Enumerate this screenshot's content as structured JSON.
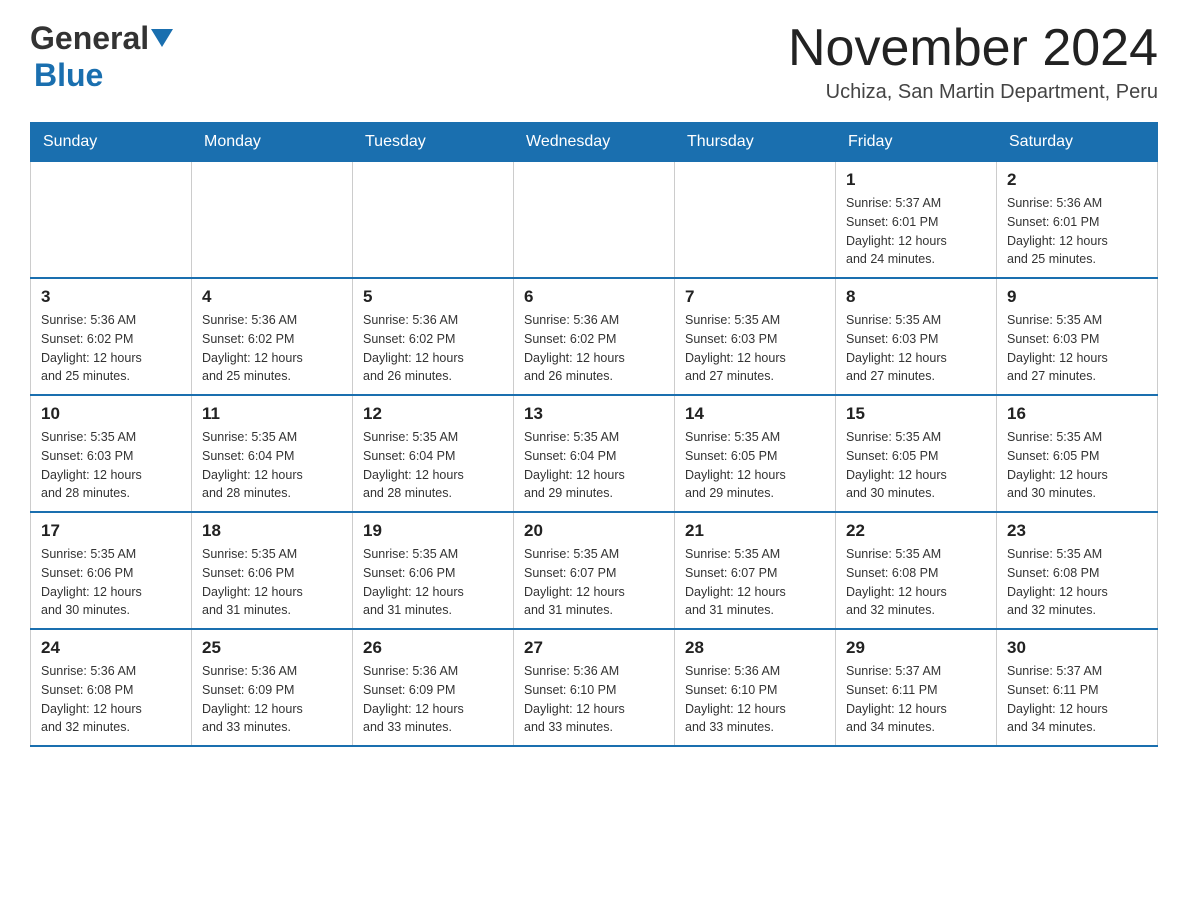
{
  "header": {
    "logo_general": "General",
    "logo_blue": "Blue",
    "main_title": "November 2024",
    "subtitle": "Uchiza, San Martin Department, Peru"
  },
  "calendar": {
    "days_of_week": [
      "Sunday",
      "Monday",
      "Tuesday",
      "Wednesday",
      "Thursday",
      "Friday",
      "Saturday"
    ],
    "weeks": [
      [
        {
          "day": "",
          "info": ""
        },
        {
          "day": "",
          "info": ""
        },
        {
          "day": "",
          "info": ""
        },
        {
          "day": "",
          "info": ""
        },
        {
          "day": "",
          "info": ""
        },
        {
          "day": "1",
          "info": "Sunrise: 5:37 AM\nSunset: 6:01 PM\nDaylight: 12 hours\nand 24 minutes."
        },
        {
          "day": "2",
          "info": "Sunrise: 5:36 AM\nSunset: 6:01 PM\nDaylight: 12 hours\nand 25 minutes."
        }
      ],
      [
        {
          "day": "3",
          "info": "Sunrise: 5:36 AM\nSunset: 6:02 PM\nDaylight: 12 hours\nand 25 minutes."
        },
        {
          "day": "4",
          "info": "Sunrise: 5:36 AM\nSunset: 6:02 PM\nDaylight: 12 hours\nand 25 minutes."
        },
        {
          "day": "5",
          "info": "Sunrise: 5:36 AM\nSunset: 6:02 PM\nDaylight: 12 hours\nand 26 minutes."
        },
        {
          "day": "6",
          "info": "Sunrise: 5:36 AM\nSunset: 6:02 PM\nDaylight: 12 hours\nand 26 minutes."
        },
        {
          "day": "7",
          "info": "Sunrise: 5:35 AM\nSunset: 6:03 PM\nDaylight: 12 hours\nand 27 minutes."
        },
        {
          "day": "8",
          "info": "Sunrise: 5:35 AM\nSunset: 6:03 PM\nDaylight: 12 hours\nand 27 minutes."
        },
        {
          "day": "9",
          "info": "Sunrise: 5:35 AM\nSunset: 6:03 PM\nDaylight: 12 hours\nand 27 minutes."
        }
      ],
      [
        {
          "day": "10",
          "info": "Sunrise: 5:35 AM\nSunset: 6:03 PM\nDaylight: 12 hours\nand 28 minutes."
        },
        {
          "day": "11",
          "info": "Sunrise: 5:35 AM\nSunset: 6:04 PM\nDaylight: 12 hours\nand 28 minutes."
        },
        {
          "day": "12",
          "info": "Sunrise: 5:35 AM\nSunset: 6:04 PM\nDaylight: 12 hours\nand 28 minutes."
        },
        {
          "day": "13",
          "info": "Sunrise: 5:35 AM\nSunset: 6:04 PM\nDaylight: 12 hours\nand 29 minutes."
        },
        {
          "day": "14",
          "info": "Sunrise: 5:35 AM\nSunset: 6:05 PM\nDaylight: 12 hours\nand 29 minutes."
        },
        {
          "day": "15",
          "info": "Sunrise: 5:35 AM\nSunset: 6:05 PM\nDaylight: 12 hours\nand 30 minutes."
        },
        {
          "day": "16",
          "info": "Sunrise: 5:35 AM\nSunset: 6:05 PM\nDaylight: 12 hours\nand 30 minutes."
        }
      ],
      [
        {
          "day": "17",
          "info": "Sunrise: 5:35 AM\nSunset: 6:06 PM\nDaylight: 12 hours\nand 30 minutes."
        },
        {
          "day": "18",
          "info": "Sunrise: 5:35 AM\nSunset: 6:06 PM\nDaylight: 12 hours\nand 31 minutes."
        },
        {
          "day": "19",
          "info": "Sunrise: 5:35 AM\nSunset: 6:06 PM\nDaylight: 12 hours\nand 31 minutes."
        },
        {
          "day": "20",
          "info": "Sunrise: 5:35 AM\nSunset: 6:07 PM\nDaylight: 12 hours\nand 31 minutes."
        },
        {
          "day": "21",
          "info": "Sunrise: 5:35 AM\nSunset: 6:07 PM\nDaylight: 12 hours\nand 31 minutes."
        },
        {
          "day": "22",
          "info": "Sunrise: 5:35 AM\nSunset: 6:08 PM\nDaylight: 12 hours\nand 32 minutes."
        },
        {
          "day": "23",
          "info": "Sunrise: 5:35 AM\nSunset: 6:08 PM\nDaylight: 12 hours\nand 32 minutes."
        }
      ],
      [
        {
          "day": "24",
          "info": "Sunrise: 5:36 AM\nSunset: 6:08 PM\nDaylight: 12 hours\nand 32 minutes."
        },
        {
          "day": "25",
          "info": "Sunrise: 5:36 AM\nSunset: 6:09 PM\nDaylight: 12 hours\nand 33 minutes."
        },
        {
          "day": "26",
          "info": "Sunrise: 5:36 AM\nSunset: 6:09 PM\nDaylight: 12 hours\nand 33 minutes."
        },
        {
          "day": "27",
          "info": "Sunrise: 5:36 AM\nSunset: 6:10 PM\nDaylight: 12 hours\nand 33 minutes."
        },
        {
          "day": "28",
          "info": "Sunrise: 5:36 AM\nSunset: 6:10 PM\nDaylight: 12 hours\nand 33 minutes."
        },
        {
          "day": "29",
          "info": "Sunrise: 5:37 AM\nSunset: 6:11 PM\nDaylight: 12 hours\nand 34 minutes."
        },
        {
          "day": "30",
          "info": "Sunrise: 5:37 AM\nSunset: 6:11 PM\nDaylight: 12 hours\nand 34 minutes."
        }
      ]
    ]
  }
}
